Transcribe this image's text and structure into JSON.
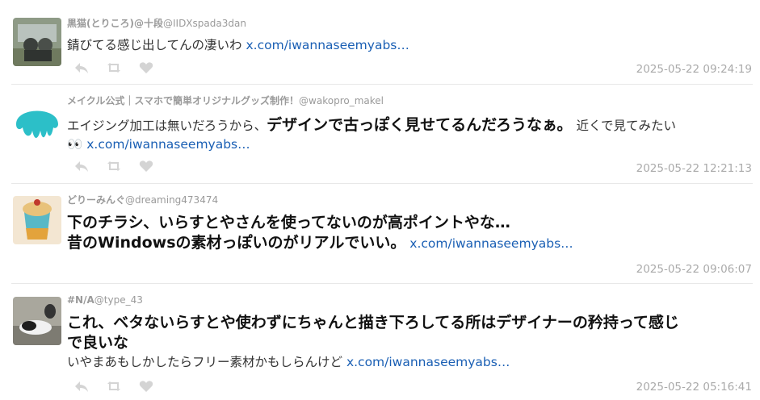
{
  "tweets": [
    {
      "name": "黒猫(とりころ)@十段",
      "handle": "@IIDXspada3dan",
      "text1": "錆びてる感じ出してんの凄いわ",
      "link": "x.com/iwannaseemyabs…",
      "timestamp": "2025-05-22 09:24:19"
    },
    {
      "name": "メイクル公式｜スマホで簡単オリジナルグッズ制作！",
      "handle": "@wakopro_makel",
      "text1": "エイジング加工は無いだろうから、",
      "text_big": "デザインで古っぽく見せてるんだろうなぁ。",
      "text2": "近くで見てみたい",
      "emoji": "👀",
      "link": "x.com/iwannaseemyabs…",
      "timestamp": "2025-05-22 12:21:13"
    },
    {
      "name": "どりーみんぐ",
      "handle": "@dreaming473474",
      "text_big1": "下のチラシ、いらすとやさんを使ってないのが高ポイントやな…",
      "text_big2": "昔のWindowsの素材っぽいのがリアルでいい。",
      "link": "x.com/iwannaseemyabs…",
      "timestamp": "2025-05-22 09:06:07"
    },
    {
      "name": "#N/A",
      "handle": "@type_43",
      "text_big1": "これ、ベタないらすとや使わずにちゃんと描き下ろしてる所はデザイナーの矜持って感じ",
      "text_big2": "で良いな",
      "text1": "いやまあもしかしたらフリー素材かもしらんけど",
      "link": "x.com/iwannaseemyabs…",
      "timestamp": "2025-05-22 05:16:41"
    }
  ],
  "actions": [
    "reply-icon",
    "retweet-icon",
    "like-icon"
  ],
  "colors": {
    "link": "#1a5fb4",
    "meta": "#9a9a9a",
    "icon": "#d4d4d4",
    "divider": "#e8e8e8"
  }
}
